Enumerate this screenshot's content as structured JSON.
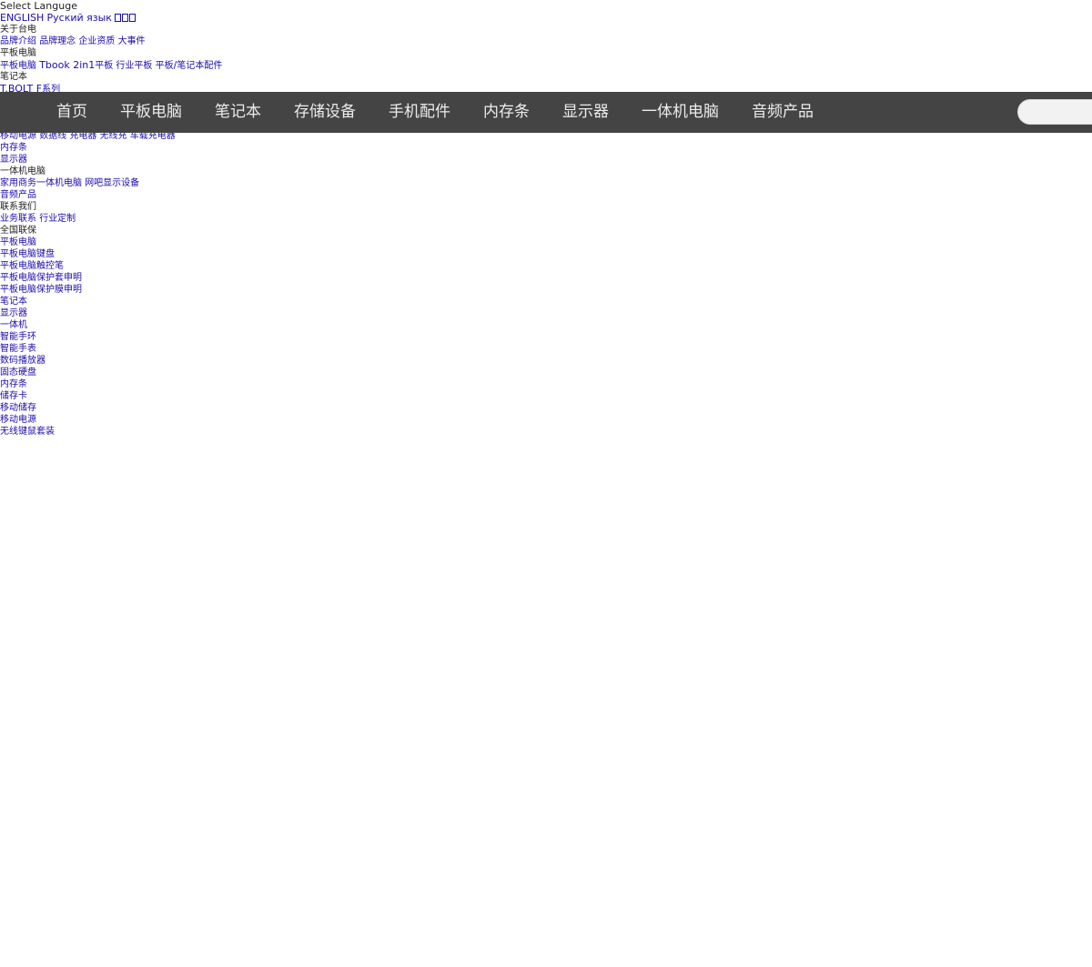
{
  "top": {
    "select_language": "Select Languge",
    "lang_english": "ENGLISH",
    "lang_russian": "Руский язык",
    "lang_third_glyphs": "□□□"
  },
  "menu": {
    "about": "关于台电",
    "about_links": [
      "品牌介绍",
      "品牌理念",
      "企业资质",
      "大事件"
    ],
    "tablet": "平板电脑",
    "tablet_links": {
      "a": "平板电脑",
      "b": "Tbook 2in1",
      "c": "平板",
      "d": "行业平板",
      "e": "平板",
      "f": "/",
      "g": "笔记本配件"
    },
    "notebook": "笔记本",
    "notebook_links": {
      "a": "T.BOLT F",
      "b": "系列"
    },
    "phone_acc_links": [
      "移动电源",
      "数据线",
      "充电器",
      "无线充",
      "车载充电器"
    ],
    "memory": "内存条",
    "monitor": "显示器",
    "aio": "一体机电脑",
    "aio_links": [
      "家用商务一体机电脑",
      "网吧显示设备"
    ],
    "audio": "音频产品",
    "contact": "联系我们",
    "contact_links": [
      "业务联系",
      "行业定制"
    ],
    "warranty": "全国联保",
    "warranty_links": [
      "平板电脑",
      "平板电脑键盘",
      "平板电脑触控笔",
      "平板电脑保护套申明",
      "平板电脑保护膜申明",
      "笔记本",
      "显示器",
      "一体机",
      "智能手环",
      "智能手表",
      "数码播放器",
      "固态硬盘",
      "内存条",
      "储存卡",
      "移动储存",
      "移动电源",
      "无线键鼠套装"
    ]
  },
  "nav": {
    "items": [
      "首页",
      "平板电脑",
      "笔记本",
      "存储设备",
      "手机配件",
      "内存条",
      "显示器",
      "一体机电脑",
      "音频产品"
    ],
    "search_placeholder": ""
  },
  "colors": {
    "nav_background": "#444444",
    "nav_text": "#ececec",
    "link": "#1a0dab"
  }
}
